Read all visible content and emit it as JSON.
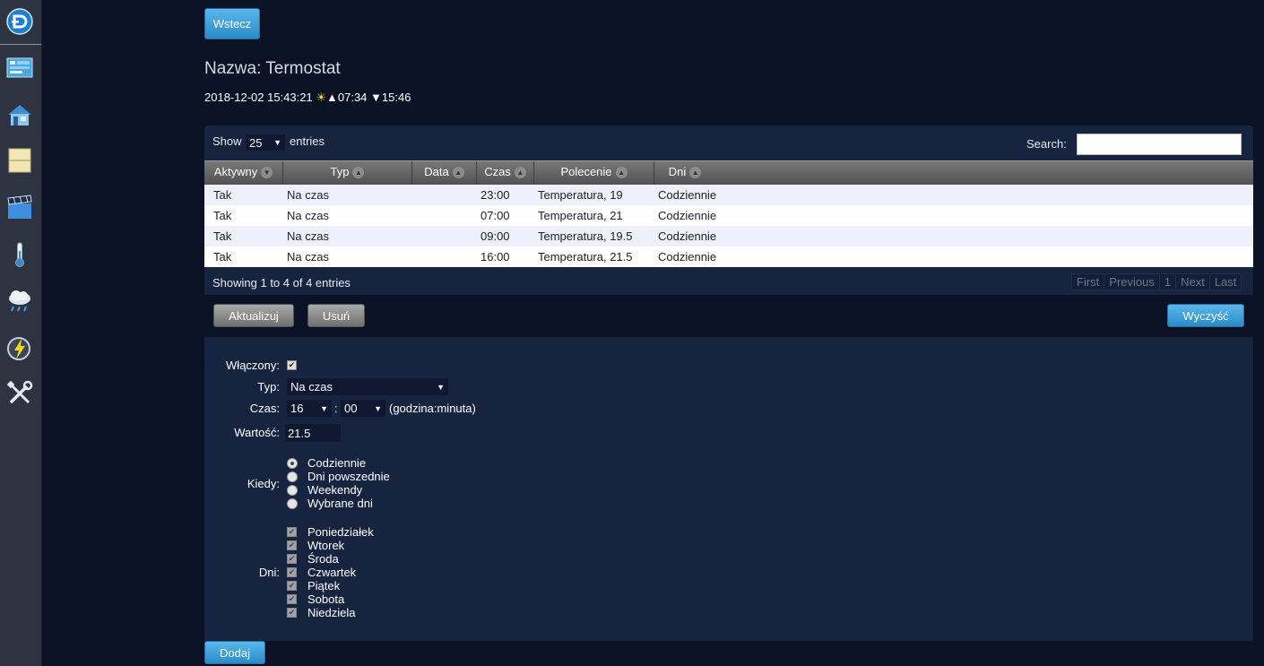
{
  "nav": {
    "back_label": "Wstecz"
  },
  "header": {
    "title": "Nazwa: Termostat",
    "datetime": "2018-12-02 15:43:21",
    "sunrise": "▲07:34",
    "sunset": "▼15:46"
  },
  "table": {
    "show_label": "Show",
    "page_size": "25",
    "entries_label": "entries",
    "search_label": "Search:",
    "search_value": "",
    "columns": [
      "Aktywny",
      "Typ",
      "Data",
      "Czas",
      "Polecenie",
      "Dni"
    ],
    "rows": [
      [
        "Tak",
        "Na czas",
        "",
        "23:00",
        "Temperatura, 19",
        "Codziennie"
      ],
      [
        "Tak",
        "Na czas",
        "",
        "07:00",
        "Temperatura, 21",
        "Codziennie"
      ],
      [
        "Tak",
        "Na czas",
        "",
        "09:00",
        "Temperatura, 19.5",
        "Codziennie"
      ],
      [
        "Tak",
        "Na czas",
        "",
        "16:00",
        "Temperatura, 21.5",
        "Codziennie"
      ]
    ],
    "info": "Showing 1 to 4 of 4 entries",
    "pager": [
      "First",
      "Previous",
      "1",
      "Next",
      "Last"
    ]
  },
  "actions": {
    "update_label": "Aktualizuj",
    "delete_label": "Usuń",
    "clear_label": "Wyczyść",
    "add_label": "Dodaj"
  },
  "form": {
    "enabled_label": "Włączony:",
    "type_label": "Typ:",
    "type_value": "Na czas",
    "time_label": "Czas:",
    "hour_value": "16",
    "time_sep": ":",
    "minute_value": "00",
    "time_hint": "(godzina:minuta)",
    "value_label": "Wartość:",
    "value_value": "21.5",
    "when_label": "Kiedy:",
    "when_options": [
      "Codziennie",
      "Dni powszednie",
      "Weekendy",
      "Wybrane dni"
    ],
    "days_label": "Dni:",
    "days": [
      "Poniedziałek",
      "Wtorek",
      "Środa",
      "Czwartek",
      "Piątek",
      "Sobota",
      "Niedziela"
    ]
  },
  "colors": {
    "background": "#0b1225",
    "panel": "#17243f",
    "sidebar": "#2d3341",
    "accent_blue": "#2a8cc9"
  }
}
